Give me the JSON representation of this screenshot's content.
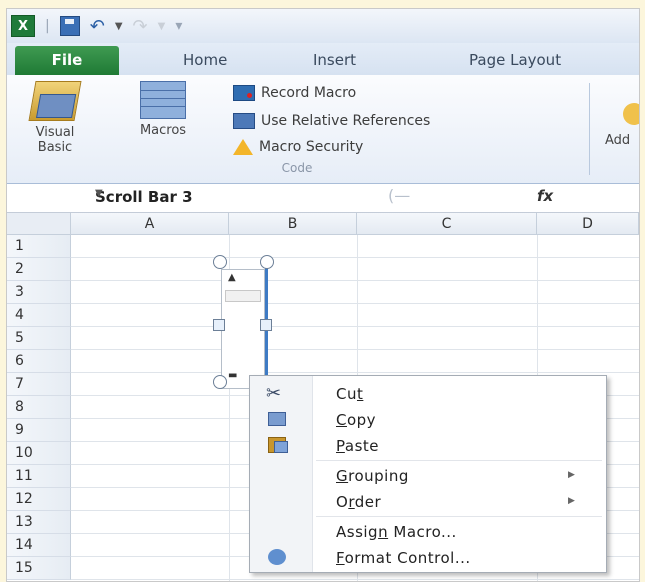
{
  "qat": {
    "separator": "|",
    "customize": "▾"
  },
  "tabs": [
    "File",
    "Home",
    "Insert",
    "Page Layout"
  ],
  "ribbon": {
    "visual_basic": "Visual Basic",
    "macros": "Macros",
    "record_macro": "Record Macro",
    "relative_references": "Use Relative References",
    "macro_security": "Macro Security",
    "code_group": "Code",
    "addins": "Add"
  },
  "formula_bar": {
    "name_box": "Scroll Bar 3",
    "fx": "fx",
    "value": ""
  },
  "grid": {
    "columns": [
      "A",
      "B",
      "C",
      "D"
    ],
    "rows": [
      "1",
      "2",
      "3",
      "4",
      "5",
      "6",
      "7",
      "8",
      "9",
      "10",
      "11",
      "12",
      "13",
      "14",
      "15"
    ]
  },
  "context_menu": {
    "items": [
      {
        "label": "Cut",
        "underline": "t",
        "icon": "cut-icon"
      },
      {
        "label": "Copy",
        "underline": "C",
        "icon": "copy-icon"
      },
      {
        "label": "Paste",
        "underline": "P",
        "icon": "paste-icon"
      },
      {
        "label": "Grouping",
        "underline": "G",
        "has_submenu": true
      },
      {
        "label": "Order",
        "underline": "r",
        "has_submenu": true
      },
      {
        "label": "Assign Macro...",
        "underline": "n"
      },
      {
        "label": "Format Control...",
        "underline": "F",
        "icon": "format-icon"
      }
    ],
    "submenu_arrow": "▶"
  }
}
